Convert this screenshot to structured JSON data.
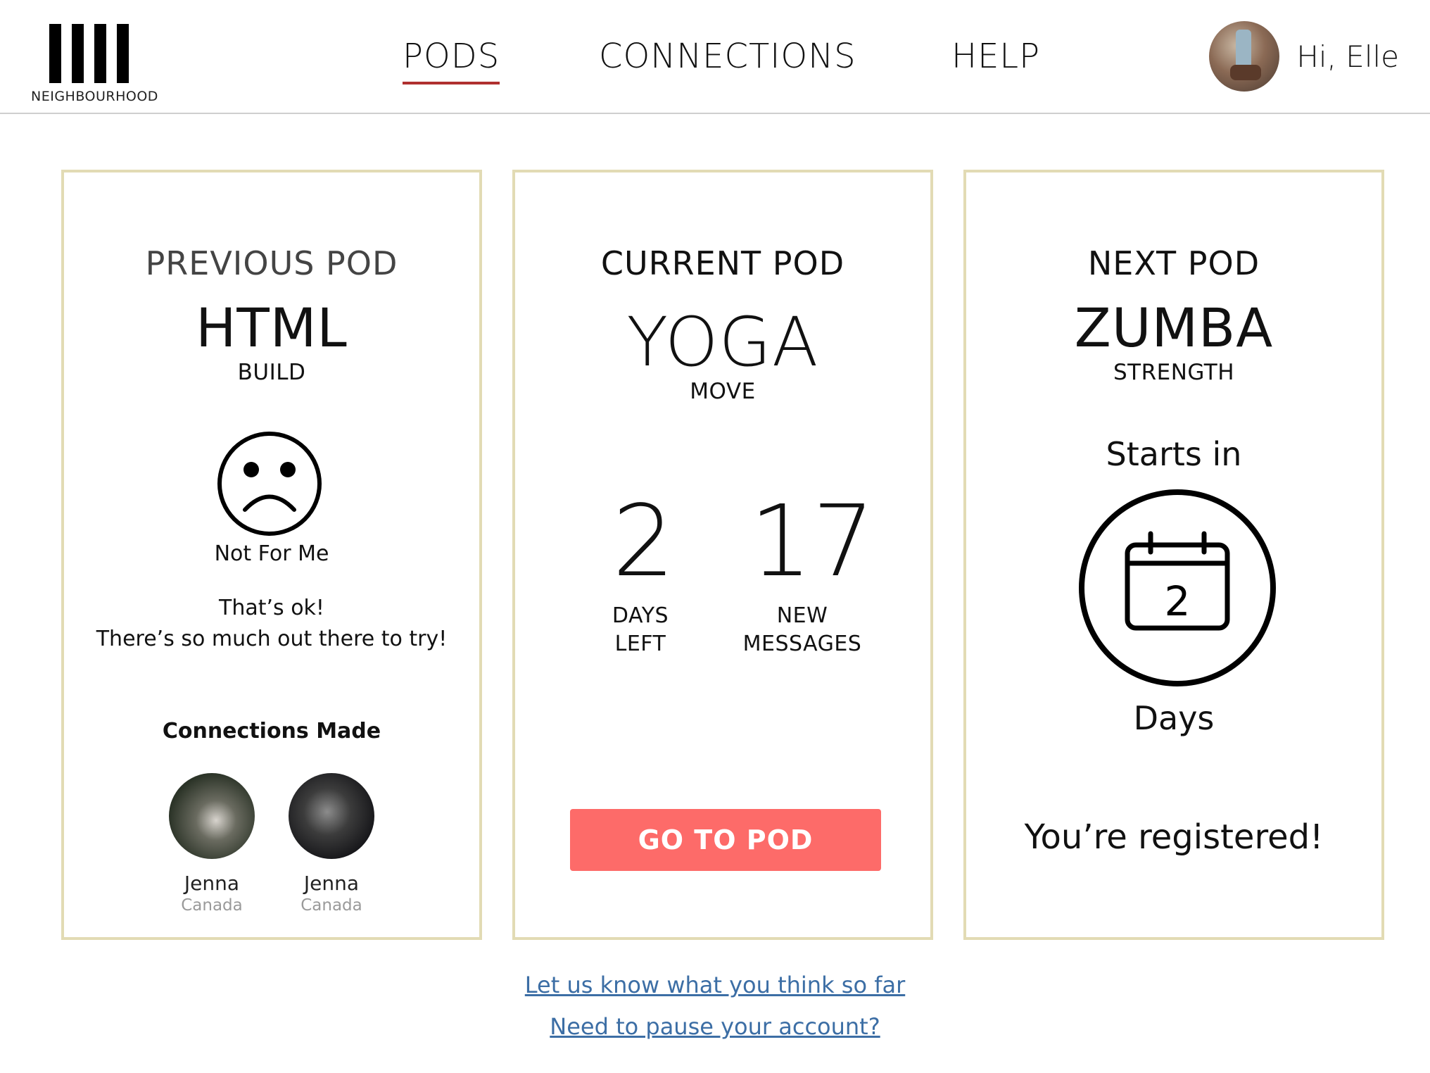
{
  "brand": {
    "name": "NEIGHBOURHOOD"
  },
  "nav": {
    "items": [
      {
        "label": "PODS",
        "active": true
      },
      {
        "label": "CONNECTIONS",
        "active": false
      },
      {
        "label": "HELP",
        "active": false
      }
    ]
  },
  "user": {
    "greeting": "Hi, Elle"
  },
  "colors": {
    "card_border": "#e2dbb4",
    "active_nav_underline": "#b0302f",
    "primary_button": "#fd6b69",
    "link": "#3c6ea5"
  },
  "previous_pod": {
    "label": "PREVIOUS POD",
    "title": "HTML",
    "category": "BUILD",
    "reaction_icon": "sad-face-icon",
    "reaction": "Not For Me",
    "message_line1": "That’s ok!",
    "message_line2": "There’s so much out there to try!",
    "connections_title": "Connections Made",
    "connections": [
      {
        "name": "Jenna",
        "location": "Canada"
      },
      {
        "name": "Jenna",
        "location": "Canada"
      }
    ]
  },
  "current_pod": {
    "label": "CURRENT POD",
    "title": "YOGA",
    "category": "MOVE",
    "days_left": "2",
    "days_left_label_1": "DAYS",
    "days_left_label_2": "LEFT",
    "new_messages": "17",
    "new_messages_label_1": "NEW",
    "new_messages_label_2": "MESSAGES",
    "button_label": "GO TO POD"
  },
  "next_pod": {
    "label": "NEXT POD",
    "title": "ZUMBA",
    "category": "STRENGTH",
    "starts_in_label": "Starts in",
    "calendar_icon": "calendar-icon",
    "starts_in_value": "2",
    "unit_label": "Days",
    "status": "You’re registered!"
  },
  "footer": {
    "feedback_link": "Let us know what you think so far",
    "pause_link": "Need to pause your account?"
  }
}
